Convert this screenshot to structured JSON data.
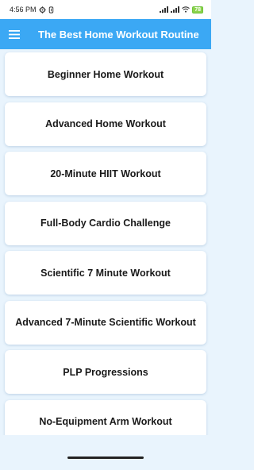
{
  "status_bar": {
    "time": "4:56 PM",
    "battery": "78"
  },
  "app_bar": {
    "title": "The Best Home Workout Routine"
  },
  "workouts": [
    {
      "label": "Beginner Home Workout"
    },
    {
      "label": "Advanced Home Workout"
    },
    {
      "label": "20-Minute HIIT Workout"
    },
    {
      "label": "Full-Body Cardio Challenge"
    },
    {
      "label": "Scientific 7 Minute Workout"
    },
    {
      "label": "Advanced 7-Minute Scientific Workout"
    },
    {
      "label": "PLP Progressions"
    },
    {
      "label": "No-Equipment Arm Workout"
    }
  ],
  "colors": {
    "app_bar": "#3ba8f4",
    "background": "#e9f4fd",
    "card": "#ffffff",
    "battery": "#8bd34c"
  }
}
